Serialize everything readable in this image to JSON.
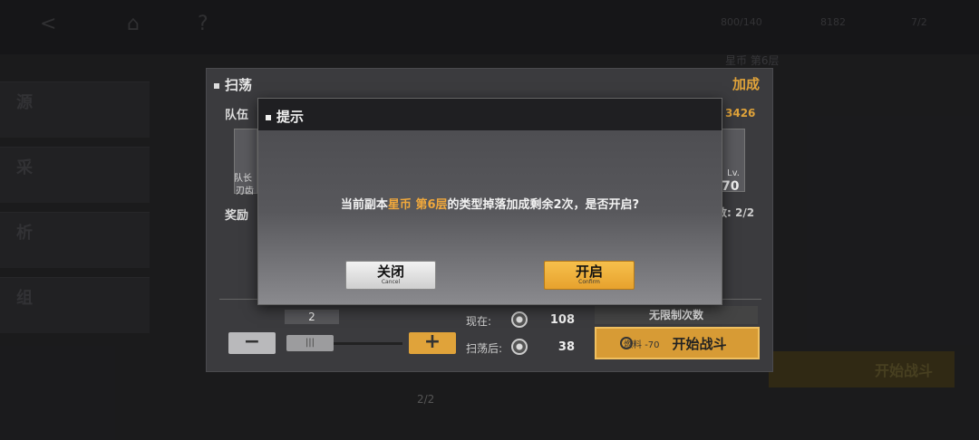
{
  "background": {
    "top_resources": [
      "800/140",
      "8182",
      "7/2"
    ],
    "side_labels": [
      "源",
      "采",
      "析",
      "组"
    ],
    "right_title": "星币 第6层",
    "right_score": "3426",
    "right_count": "数: 2/2",
    "right_start": "开始战斗"
  },
  "panel": {
    "title": "扫荡",
    "bonus_label": "加成",
    "team_label": "队伍",
    "reward_label": "奖励",
    "team_captain_label": "队长",
    "team_member_name": "刃齿",
    "level_label": "Lv.",
    "level_value": "70",
    "sweep_count": "2",
    "minus_label": "−",
    "plus_label": "+",
    "slider_knob": "|||",
    "current_label": "现在:",
    "current_value": "108",
    "after_label": "扫荡后:",
    "after_value": "38",
    "unlimited_label": "无限制次数",
    "fuel_label": "燃料",
    "fuel_cost": "-70",
    "start_label": "开始战斗",
    "bottom_count": "2/2"
  },
  "modal": {
    "title": "提示",
    "message_prefix": "当前副本",
    "message_highlight": "星币 第6层",
    "message_suffix": "的类型掉落加成剩余2次，是否开启?",
    "cancel_label": "关闭",
    "cancel_sub": "Cancel",
    "confirm_label": "开启",
    "confirm_sub": "Confirm"
  },
  "colors": {
    "accent": "#e0a33a",
    "modal_header": "#1f1f22"
  }
}
